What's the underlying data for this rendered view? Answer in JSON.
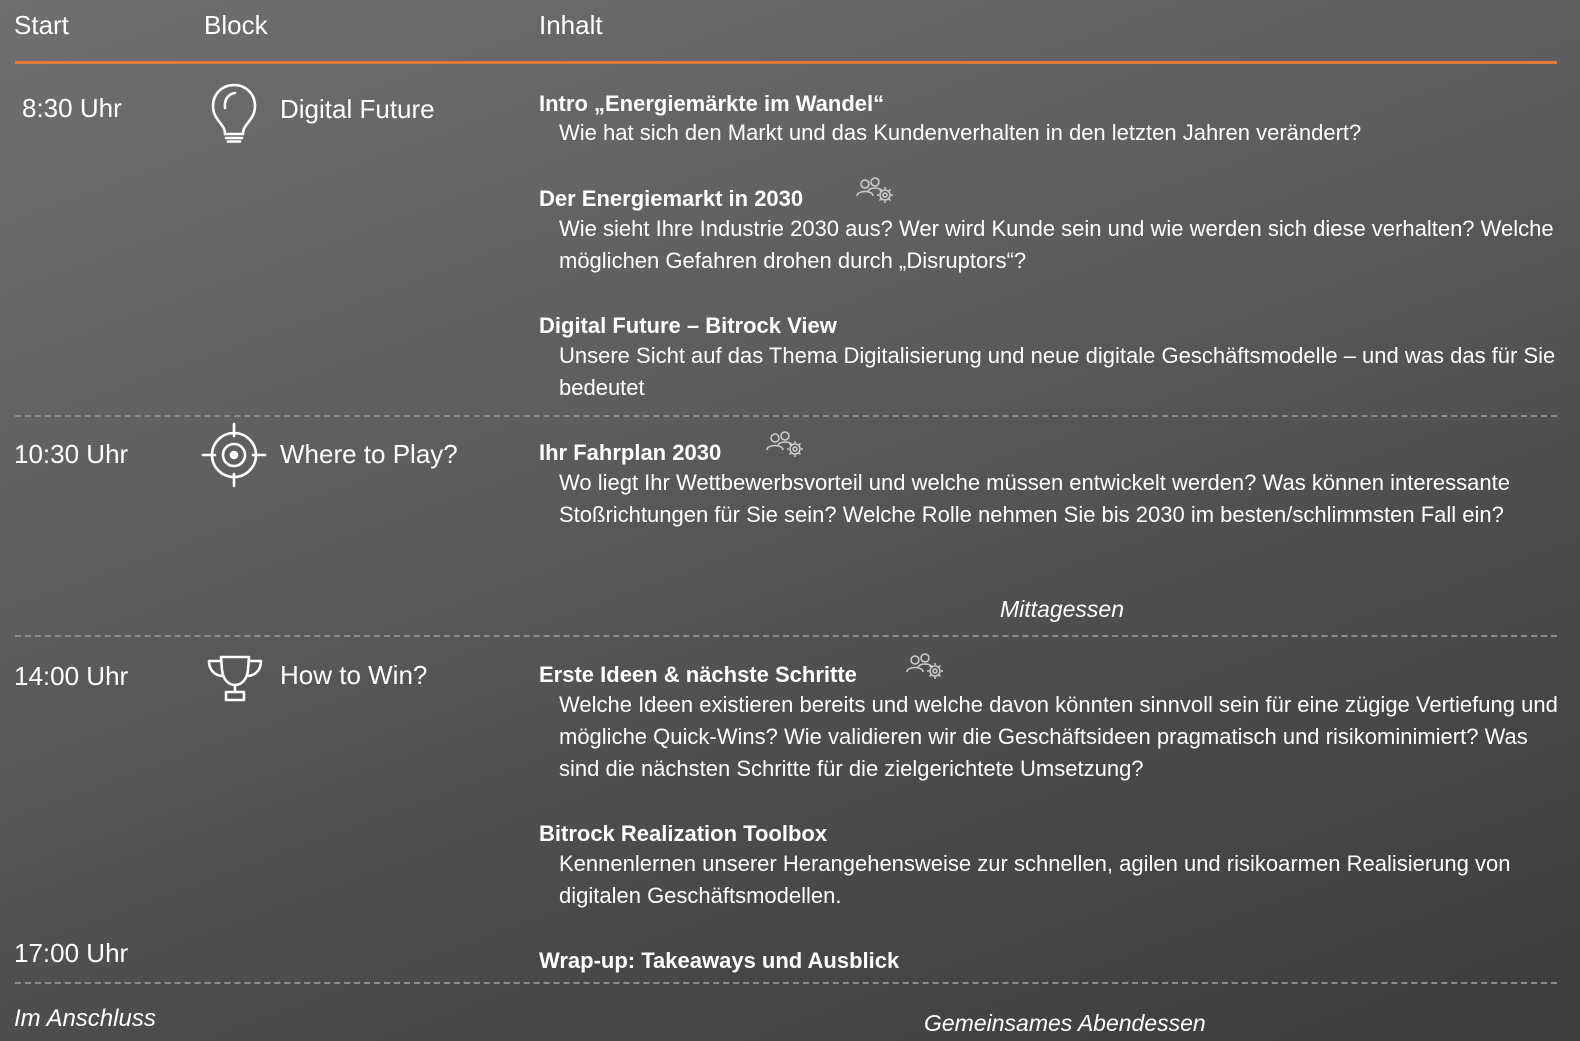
{
  "header": {
    "start": "Start",
    "block": "Block",
    "content": "Inhalt"
  },
  "rows": [
    {
      "time": "8:30 Uhr",
      "block": "Digital Future",
      "block_icon": "lightbulb-icon",
      "items": [
        {
          "title": "Intro „Energiemärkte im Wandel“",
          "text": "Wie hat sich den Markt und das Kundenverhalten in den letzten Jahren verändert?"
        },
        {
          "title": "Der Energiemarkt in 2030",
          "icon": "team-settings-icon",
          "text": "Wie sieht Ihre Industrie 2030 aus? Wer wird Kunde sein und wie werden sich diese verhalten? Welche möglichen Gefahren drohen durch „Disruptors“?"
        },
        {
          "title": "Digital Future – Bitrock View",
          "text": "Unsere Sicht auf das Thema Digitalisierung und neue digitale Geschäftsmodelle – und was das für Sie bedeutet"
        }
      ]
    },
    {
      "time": "10:30 Uhr",
      "block": "Where to Play?",
      "block_icon": "target-icon",
      "items": [
        {
          "title": "Ihr Fahrplan 2030",
          "icon": "team-settings-icon",
          "text": "Wo liegt Ihr Wettbewerbsvorteil und welche müssen entwickelt werden? Was können interessante Stoßrichtungen für Sie sein? Welche Rolle nehmen Sie bis 2030 im besten/schlimmsten Fall ein?"
        }
      ],
      "break": "Mittagessen"
    },
    {
      "time": "14:00 Uhr",
      "block": "How to Win?",
      "block_icon": "trophy-icon",
      "items": [
        {
          "title": "Erste Ideen & nächste Schritte",
          "icon": "team-settings-icon",
          "text": "Welche Ideen existieren bereits und welche davon könnten sinnvoll sein für eine zügige Vertiefung und mögliche Quick-Wins? Wie validieren wir die Geschäftsideen pragmatisch und risikominimiert? Was sind die nächsten Schritte für die zielgerichtete Umsetzung?"
        },
        {
          "title": "Bitrock Realization Toolbox",
          "text": "Kennenlernen unserer Herangehensweise zur schnellen, agilen und risikoarmen Realisierung von digitalen Geschäftsmodellen."
        }
      ]
    },
    {
      "time": "17:00 Uhr",
      "items": [
        {
          "title": "Wrap-up: Takeaways und Ausblick"
        }
      ]
    }
  ],
  "closing": {
    "label": "Im Anschluss",
    "event": "Gemeinsames Abendessen"
  },
  "colors": {
    "accent": "#e0783a",
    "divider": "#8c8c8c"
  }
}
